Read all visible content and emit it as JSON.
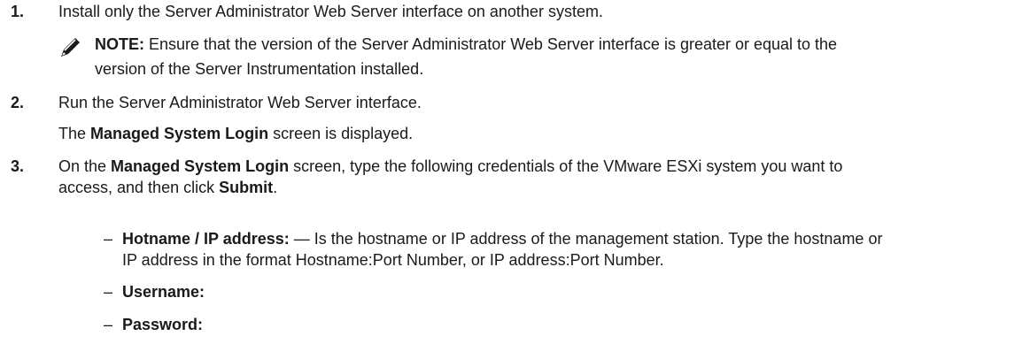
{
  "steps": [
    {
      "number": "1.",
      "text": "Install only the Server Administrator Web Server interface on another system."
    },
    {
      "number": "2.",
      "text": "Run the Server Administrator Web Server interface."
    },
    {
      "number": "3."
    }
  ],
  "note": {
    "label": "NOTE:",
    "line1": " Ensure that the version of the Server Administrator Web Server interface is greater or equal to the",
    "line2": "version of the Server Instrumentation installed."
  },
  "step2_result": {
    "pre": "The ",
    "bold": "Managed System Login",
    "post": " screen is displayed."
  },
  "step3": {
    "pre": "On the ",
    "bold": "Managed System Login",
    "mid": " screen, type the following credentials of the VMware ESXi system you want to",
    "line2_pre": "access, and then click ",
    "line2_bold": "Submit",
    "line2_post": "."
  },
  "credentials": [
    {
      "dash": "–",
      "label": "Hotname / IP address:",
      "text": " — Is the hostname or IP address of the management station. Type the hostname or",
      "text2": "IP address in the format Hostname:Port Number, or IP address:Port Number."
    },
    {
      "dash": "–",
      "label": "Username:"
    },
    {
      "dash": "–",
      "label": "Password:"
    }
  ],
  "icons": {
    "note": "pencil-note-icon"
  }
}
